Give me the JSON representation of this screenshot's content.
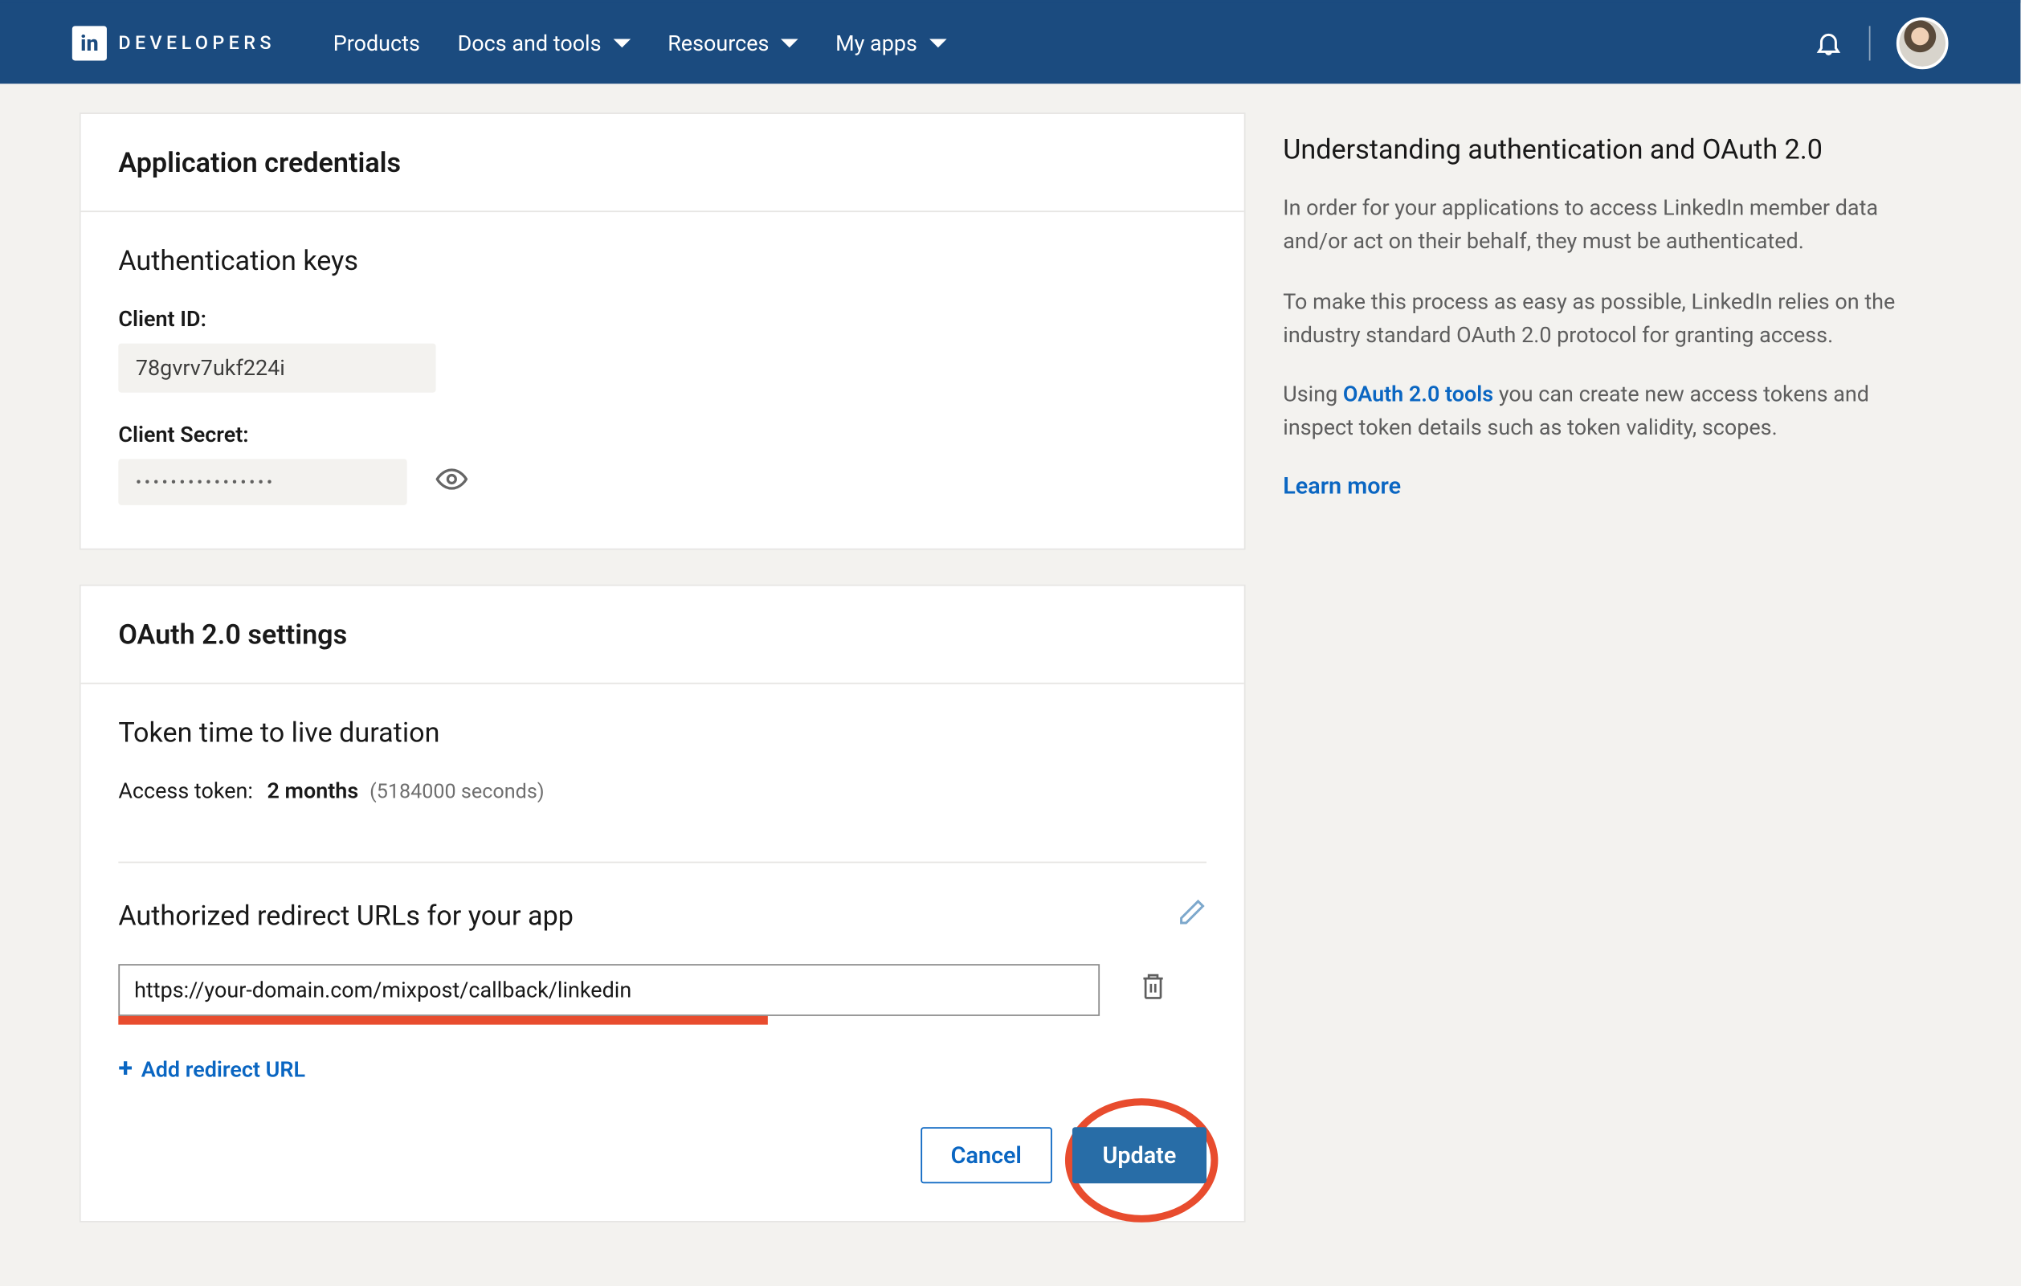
{
  "brand": {
    "text": "DEVELOPERS"
  },
  "nav": {
    "products": "Products",
    "docs": "Docs and tools",
    "resources": "Resources",
    "myapps": "My apps"
  },
  "cards": {
    "creds": {
      "title": "Application credentials",
      "authKeys": "Authentication keys",
      "clientIdLabel": "Client ID:",
      "clientIdValue": "78gvrv7ukf224i",
      "clientSecretLabel": "Client Secret:",
      "clientSecretValue": "••••••••••••••••"
    },
    "oauth": {
      "title": "OAuth 2.0 settings",
      "ttlHeading": "Token time to live duration",
      "ttlLabel": "Access token:",
      "ttlValue": "2 months",
      "ttlSeconds": "(5184000 seconds)",
      "redirectTitle": "Authorized redirect URLs for your app",
      "redirectValue": "https://your-domain.com/mixpost/callback/linkedin",
      "addLink": "Add redirect URL",
      "cancel": "Cancel",
      "update": "Update"
    }
  },
  "side": {
    "title": "Understanding authentication and OAuth 2.0",
    "p1": "In order for your applications to access LinkedIn member data and/or act on their behalf, they must be authenticated.",
    "p2": "To make this process as easy as possible, LinkedIn relies on the industry standard OAuth 2.0 protocol for granting access.",
    "p3a": "Using ",
    "p3link": "OAuth 2.0 tools",
    "p3b": " you can create new access tokens and inspect token details such as token validity, scopes.",
    "learn": "Learn more"
  }
}
